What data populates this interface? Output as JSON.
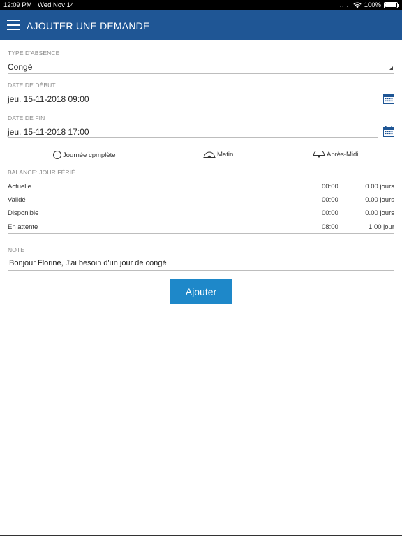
{
  "status_bar": {
    "time": "12:09 PM",
    "date": "Wed Nov 14",
    "signal_dots": "....",
    "battery": "100%"
  },
  "app_bar": {
    "title": "AJOUTER UNE DEMANDE",
    "menu_icon": "hamburger-menu-icon",
    "color": "#1f5695"
  },
  "form": {
    "absence_type": {
      "label": "TYPE D'ABSENCE",
      "value": "Congé"
    },
    "start_date": {
      "label": "DATE DE DÉBUT",
      "value": "jeu. 15-11-2018 09:00",
      "icon": "calendar-icon"
    },
    "end_date": {
      "label": "DATE DE FIN",
      "value": "jeu. 15-11-2018 17:00",
      "icon": "calendar-icon"
    },
    "period_options": [
      {
        "label": "Journée cpmplète",
        "icon": "radio-circle-icon"
      },
      {
        "label": "Matin",
        "icon": "half-day-morning-icon"
      },
      {
        "label": "Après-Midi",
        "icon": "half-day-afternoon-icon"
      }
    ]
  },
  "balance": {
    "title": "BALANCE: JOUR FÉRIÉ",
    "rows": [
      {
        "name": "Actuelle",
        "hours": "00:00",
        "days": "0.00 jours"
      },
      {
        "name": "Validé",
        "hours": "00:00",
        "days": "0.00 jours"
      },
      {
        "name": "Disponible",
        "hours": "00:00",
        "days": "0.00 jours"
      },
      {
        "name": "En attente",
        "hours": "08:00",
        "days": "1.00 jour"
      }
    ]
  },
  "note": {
    "label": "NOTE",
    "value": "Bonjour Florine, J'ai besoin d'un jour de congé"
  },
  "submit_button": {
    "label": "Ajouter",
    "color": "#1e88c9"
  },
  "accent_color": "#1f5695"
}
